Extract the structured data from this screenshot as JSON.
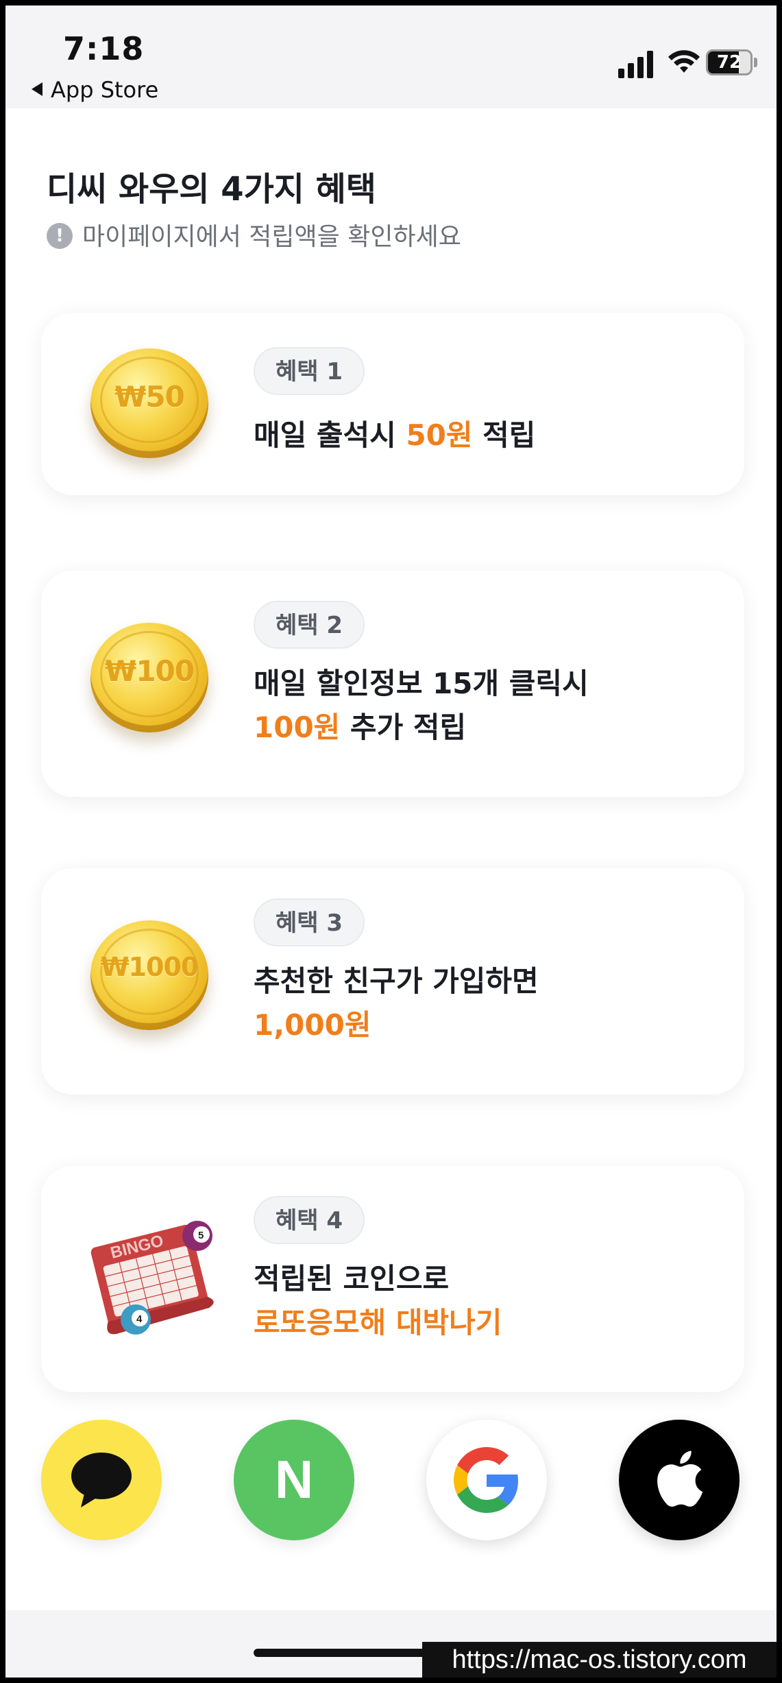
{
  "status_bar": {
    "time": "7:18",
    "back_label": "App Store",
    "battery_level": "72"
  },
  "header": {
    "title": "디씨 와우의 4가지 혜택",
    "subtitle": "마이페이지에서 적립액을 확인하세요",
    "info_glyph": "!"
  },
  "benefits": [
    {
      "badge": "혜택 1",
      "icon": "coin-icon",
      "coin_label": "₩50",
      "line1": {
        "before": "매일 출석시 ",
        "highlight": "50원",
        "after": " 적립"
      }
    },
    {
      "badge": "혜택 2",
      "icon": "coin-icon",
      "coin_label": "₩100",
      "line1": {
        "text": "매일 할인정보 15개 클릭시"
      },
      "line2": {
        "highlight": "100원",
        "after": " 추가 적립"
      }
    },
    {
      "badge": "혜택 3",
      "icon": "coin-icon",
      "coin_label": "₩1000",
      "line1": {
        "text": "추천한 친구가 가입하면"
      },
      "line2": {
        "highlight": "1,000원"
      }
    },
    {
      "badge": "혜택 4",
      "icon": "bingo-lotto-icon",
      "bingo_text": "BINGO",
      "ball_numbers": [
        "5",
        "4"
      ],
      "line1": {
        "text": "적립된 코인으로"
      },
      "line2": {
        "highlight": "로또응모해 대박나기"
      }
    }
  ],
  "social_login": [
    {
      "name": "kakao",
      "icon": "kakao-talk-icon",
      "color": "#fbe44c"
    },
    {
      "name": "naver",
      "icon": "naver-icon",
      "glyph": "N",
      "color": "#58c562"
    },
    {
      "name": "google",
      "icon": "google-icon",
      "color": "#ffffff"
    },
    {
      "name": "apple",
      "icon": "apple-icon",
      "color": "#000000"
    }
  ],
  "watermark": "https://mac-os.tistory.com",
  "colors": {
    "accent_orange": "#f07e1b",
    "text_dark": "#1a1d23",
    "text_gray": "#6b7079"
  }
}
